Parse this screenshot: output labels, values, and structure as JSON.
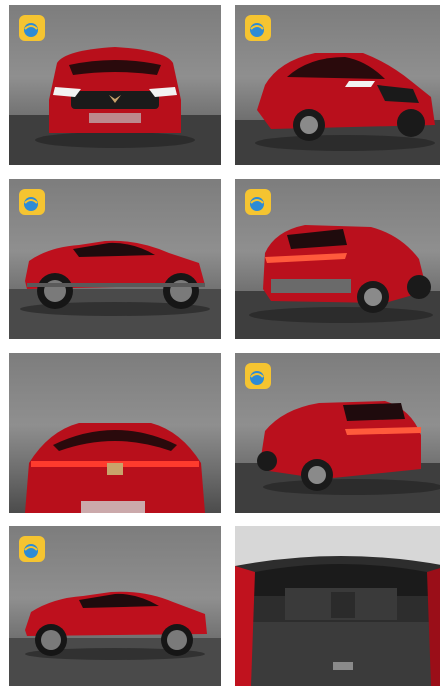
{
  "gallery": {
    "photos": [
      {
        "view": "front",
        "has_badge": true
      },
      {
        "view": "front-three-quarter",
        "has_badge": true
      },
      {
        "view": "side-left",
        "has_badge": true
      },
      {
        "view": "rear-three-quarter",
        "has_badge": true
      },
      {
        "view": "rear-closeup",
        "has_badge": false
      },
      {
        "view": "rear-three-quarter-left",
        "has_badge": true
      },
      {
        "view": "side-left-far",
        "has_badge": true
      },
      {
        "view": "trunk-interior",
        "has_badge": false
      }
    ],
    "badge_icon": "watermark-logo-icon",
    "colors": {
      "car_red": "#c0121e",
      "wall_gray": "#8a8a8a",
      "floor_dark": "#3f3f3f"
    }
  }
}
